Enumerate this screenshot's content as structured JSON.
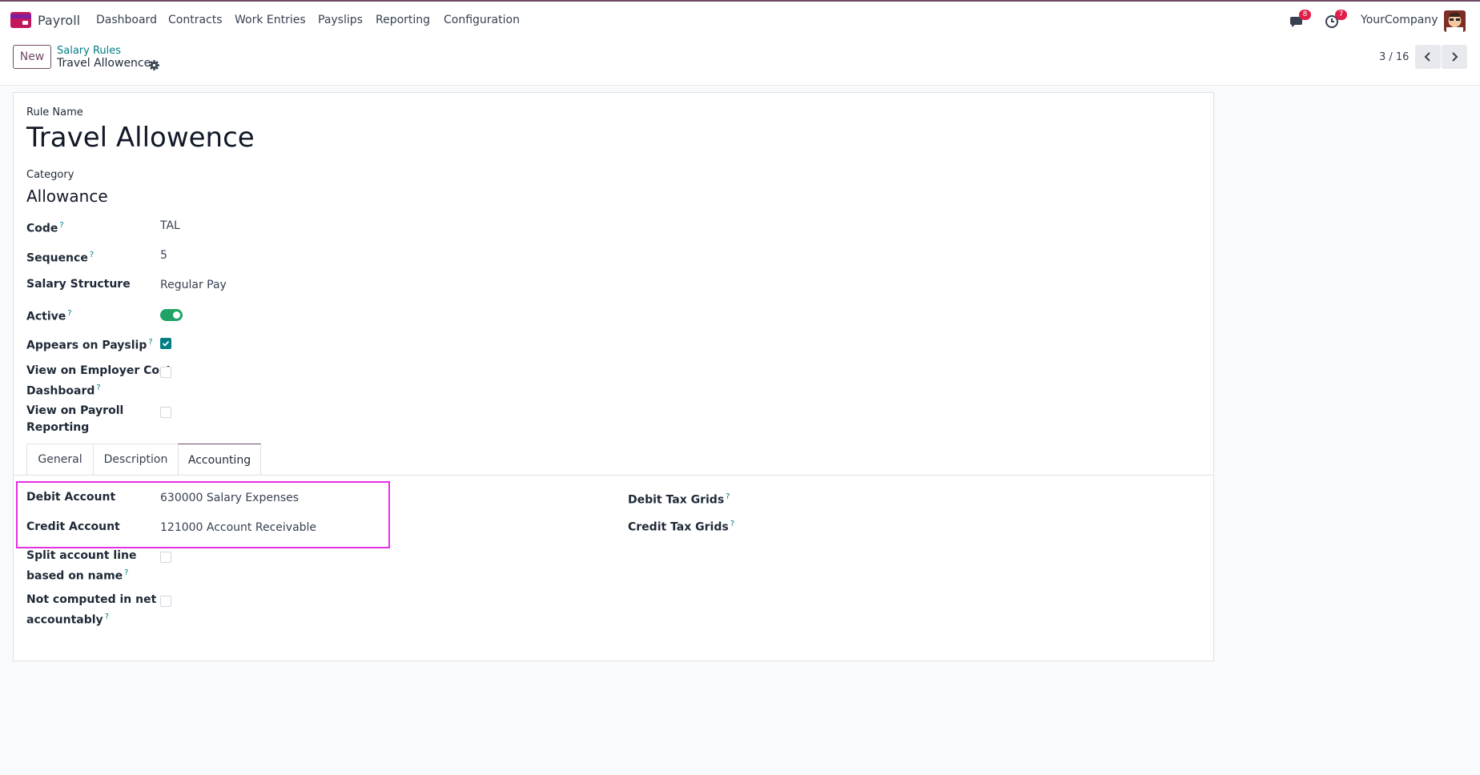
{
  "navbar": {
    "app_name": "Payroll",
    "menu": [
      "Dashboard",
      "Contracts",
      "Work Entries",
      "Payslips",
      "Reporting",
      "Configuration"
    ],
    "messages_count": "8",
    "activities_count": "7",
    "company": "YourCompany"
  },
  "control": {
    "new_label": "New",
    "breadcrumb_parent": "Salary Rules",
    "breadcrumb_current": "Travel Allowence",
    "pager": "3 / 16"
  },
  "form": {
    "rule_name_label": "Rule Name",
    "rule_name": "Travel Allowence",
    "category_label": "Category",
    "category": "Allowance",
    "code_label": "Code",
    "code": "TAL",
    "sequence_label": "Sequence",
    "sequence": "5",
    "structure_label": "Salary Structure",
    "structure": "Regular Pay",
    "active_label": "Active",
    "active": true,
    "appears_label": "Appears on Payslip",
    "appears": true,
    "employer_cost_label_1": "View on Employer Cost",
    "employer_cost_label_2": "Dashboard",
    "employer_cost": false,
    "payroll_reporting_label_1": "View on Payroll",
    "payroll_reporting_label_2": "Reporting",
    "payroll_reporting": false
  },
  "tabs": [
    "General",
    "Description",
    "Accounting"
  ],
  "active_tab": "Accounting",
  "accounting": {
    "debit_account_label": "Debit Account",
    "debit_account": "630000 Salary Expenses",
    "credit_account_label": "Credit Account",
    "credit_account": "121000 Account Receivable",
    "split_label_1": "Split account line",
    "split_label_2": "based on name",
    "split": false,
    "not_computed_label_1": "Not computed in net",
    "not_computed_label_2": "accountably",
    "not_computed": false,
    "debit_tax_grids_label": "Debit Tax Grids",
    "credit_tax_grids_label": "Credit Tax Grids"
  },
  "colors": {
    "brand": "#714b67",
    "accent": "#017e84",
    "toggle_on": "#21a366",
    "badge": "#e11d48",
    "highlight": "#e62fe6"
  },
  "icons": [
    "payroll-app-icon",
    "chat-icon",
    "clock-icon",
    "gear-icon",
    "chevron-left-icon",
    "chevron-right-icon",
    "check-icon"
  ]
}
